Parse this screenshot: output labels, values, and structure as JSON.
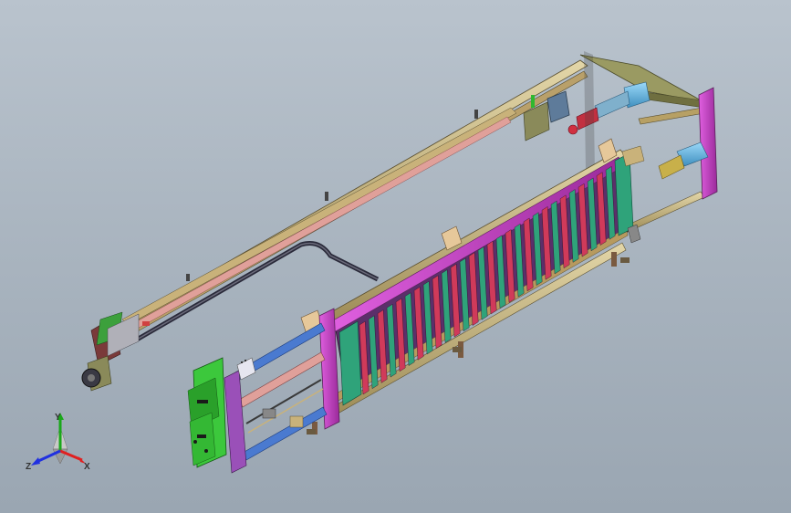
{
  "triad": {
    "x_label": "X",
    "y_label": "Y",
    "z_label": "Z",
    "x_color": "#e02020",
    "y_color": "#1aa81a",
    "z_color": "#2030e0"
  },
  "colors": {
    "background_top": "#b9c3cd",
    "background_bottom": "#9aa6b2",
    "rail_tan": "#c9b27a",
    "frame_olive": "#8a8a5a",
    "panel_magenta": "#c040c0",
    "slat_red": "#d03a5a",
    "slat_green": "#2fa37a",
    "slat_teal": "#1f8f7a",
    "motor_cyan": "#6ab8e0",
    "board_green": "#3cc83c",
    "accent_blue": "#3a7bd5"
  }
}
